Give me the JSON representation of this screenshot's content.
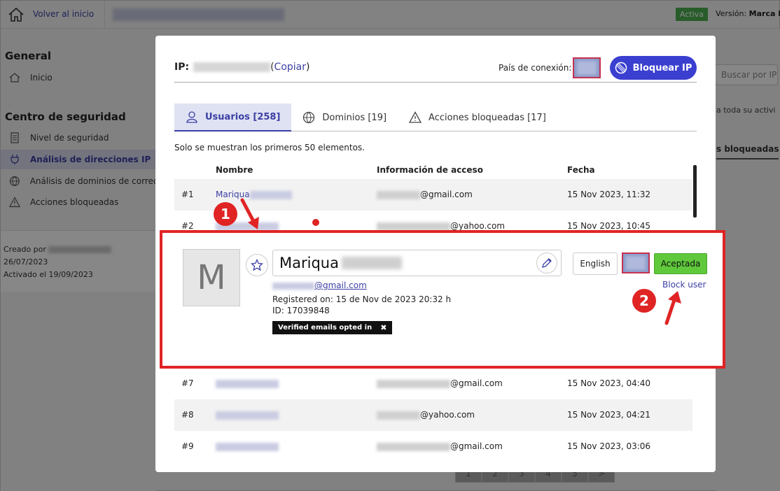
{
  "topbar": {
    "home_label": "Volver al inicio",
    "status_badge": "Activa",
    "version_label": "Versión:",
    "version_value": "Marca B"
  },
  "sidebar": {
    "section_general": "General",
    "item_inicio": "Inicio",
    "section_security": "Centro de seguridad",
    "items": [
      {
        "label": "Nivel de seguridad",
        "icon": "document-icon"
      },
      {
        "label": "Análisis de direcciones IP",
        "icon": "plug-icon"
      },
      {
        "label": "Análisis de dominios de correo",
        "icon": "globe-icon"
      },
      {
        "label": "Acciones bloqueadas",
        "icon": "warning-icon"
      }
    ],
    "meta_created": "Creado por",
    "meta_date": "26/07/2023",
    "meta_activated": "Activado el 19/09/2023"
  },
  "background": {
    "search_placeholder": "Buscar por IP",
    "text": "a toda su activi",
    "tab": "s bloqueadas",
    "pager": [
      "1",
      "2",
      "3",
      "4",
      "5",
      ">"
    ]
  },
  "modal": {
    "ip_label": "IP:",
    "copy_open": "(",
    "copy_label": "Copiar",
    "copy_close": ")",
    "country_label": "País de conexión:",
    "block_ip_label": "Bloquear IP",
    "tabs": [
      {
        "label": "Usuarios [258]",
        "icon": "user-icon"
      },
      {
        "label": "Dominios [19]",
        "icon": "globe-icon"
      },
      {
        "label": "Acciones bloqueadas [17]",
        "icon": "warning-icon"
      }
    ],
    "note": "Solo se muestran los primeros 50 elementos.",
    "columns": [
      "Nombre",
      "Información de acceso",
      "Fecha"
    ],
    "rows": [
      {
        "num": "#1",
        "name": "Mariqua",
        "email_domain": "@gmail.com",
        "date": "15 Nov 2023, 11:32"
      },
      {
        "num": "#2",
        "name": "",
        "email_domain": "@yahoo.com",
        "date": "15 Nov 2023, 10:45"
      },
      {
        "num": "#7",
        "name": "",
        "email_domain": "@gmail.com",
        "date": "15 Nov 2023, 04:40"
      },
      {
        "num": "#8",
        "name": "",
        "email_domain": "@yahoo.com",
        "date": "15 Nov 2023, 04:21"
      },
      {
        "num": "#9",
        "name": "",
        "email_domain": "@gmail.com",
        "date": "15 Nov 2023, 03:06"
      }
    ]
  },
  "detail": {
    "avatar_letter": "M",
    "name": "Mariqua",
    "email_domain": "@gmail.com",
    "registered": "Registered on: 15 de Nov de 2023 20:32 h",
    "id": "ID: 17039848",
    "verified_tag": "Verified emails opted in",
    "verified_close": "✖",
    "language_button": "English",
    "accept_button": "Aceptada",
    "block_user_link": "Block user"
  },
  "annotations": {
    "step1": "1",
    "step2": "2"
  },
  "colors": {
    "accent": "#3b3fa3",
    "primary_button": "#3b3fd0",
    "accept": "#5fc93b",
    "highlight": "#e02424"
  }
}
